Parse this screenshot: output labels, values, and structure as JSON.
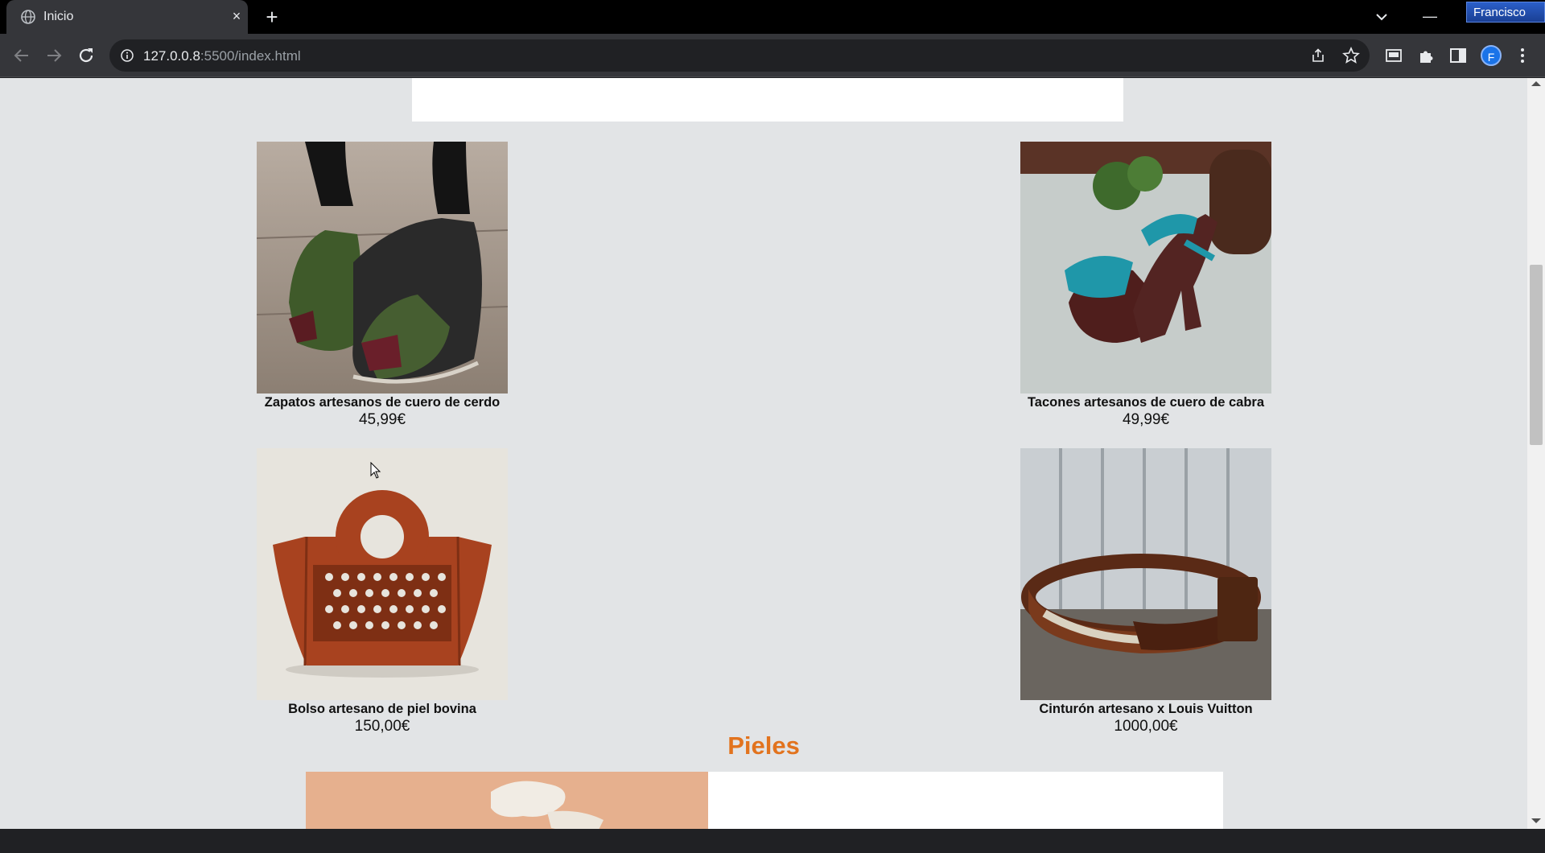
{
  "browser": {
    "tab_title": "Inicio",
    "tab_close_glyph": "×",
    "new_tab_glyph": "+",
    "url_host": "127.0.0.8",
    "url_path": ":5500/index.html",
    "profile_name": "Francisco",
    "avatar_letter": "F",
    "minimize_glyph": "—"
  },
  "top_banner": {},
  "products": [
    {
      "name": "Zapatos artesanos de cuero de cerdo",
      "price": "45,99€"
    },
    {
      "name": "Tacones artesanos de cuero de cabra",
      "price": "49,99€"
    },
    {
      "name": "Bolso artesano de piel bovina",
      "price": "150,00€"
    },
    {
      "name": "Cinturón artesano x Louis Vuitton",
      "price": "1000,00€"
    }
  ],
  "section": {
    "title": "Pieles"
  },
  "colors": {
    "page_background": "#e2e4e6",
    "section_title": "#e2731e",
    "chrome_dark": "#35363a",
    "avatar_blue": "#1a73e8"
  }
}
